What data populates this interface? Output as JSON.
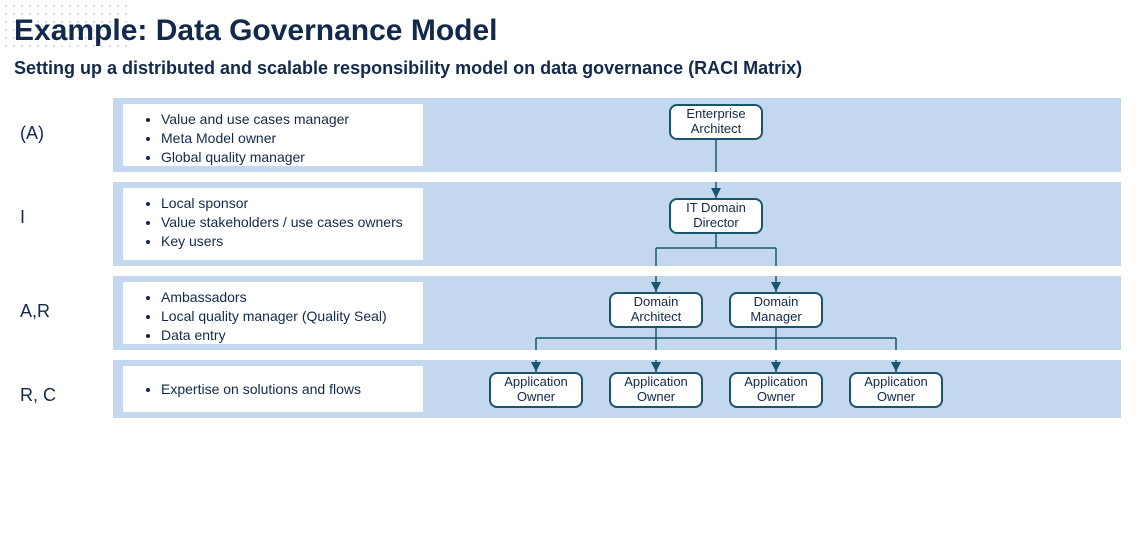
{
  "title": "Example: Data Governance Model",
  "subtitle": "Setting up a distributed and scalable responsibility model on data governance (RACI Matrix)",
  "bands": [
    {
      "label": "(A)",
      "bullets": [
        "Value and use cases manager",
        "Meta Model owner",
        "Global quality manager"
      ]
    },
    {
      "label": "I",
      "bullets": [
        "Local sponsor",
        "Value stakeholders / use cases owners",
        "Key users"
      ]
    },
    {
      "label": "A,R",
      "bullets": [
        "Ambassadors",
        "Local quality manager (Quality Seal)",
        "Data entry"
      ]
    },
    {
      "label": "R, C",
      "bullets": [
        "Expertise on solutions and flows"
      ]
    }
  ],
  "org": {
    "l1": "Enterprise Architect",
    "l2": "IT Domain Director",
    "l3a": "Domain Architect",
    "l3b": "Domain Manager",
    "l4a": "Application Owner",
    "l4b": "Application Owner",
    "l4c": "Application Owner",
    "l4d": "Application Owner"
  }
}
